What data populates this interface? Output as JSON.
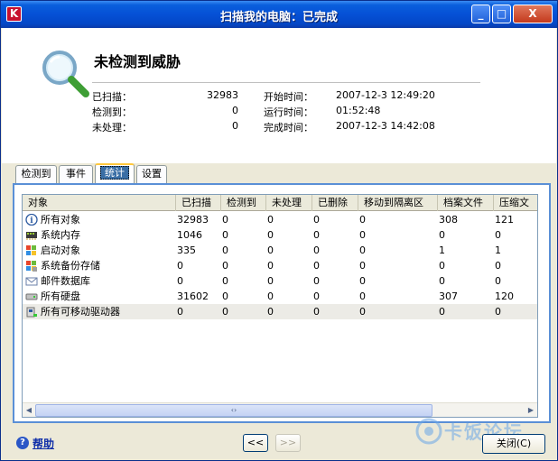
{
  "window": {
    "title": "扫描我的电脑：已完成",
    "app_icon_letter": "K",
    "controls": {
      "minimize": "_",
      "maximize": "□",
      "close": "X"
    }
  },
  "header": {
    "headline": "未检测到威胁",
    "stats": [
      {
        "label": "已扫描：",
        "value": "32983",
        "label2": "开始时间：",
        "value2": "2007-12-3 12:49:20"
      },
      {
        "label": "检测到：",
        "value": "0",
        "label2": "运行时间：",
        "value2": "01:52:48"
      },
      {
        "label": "未处理：",
        "value": "0",
        "label2": "完成时间：",
        "value2": "2007-12-3 14:42:08"
      }
    ]
  },
  "tabs": [
    {
      "label": "检测到",
      "active": false
    },
    {
      "label": "事件",
      "active": false
    },
    {
      "label": "统计",
      "active": true
    },
    {
      "label": "设置",
      "active": false
    }
  ],
  "table": {
    "columns": [
      "对象",
      "已扫描",
      "检测到",
      "未处理",
      "已删除",
      "移动到隔离区",
      "档案文件",
      "压缩文"
    ],
    "rows": [
      {
        "icon": "info-icon",
        "cells": [
          "所有对象",
          "32983",
          "0",
          "0",
          "0",
          "0",
          "308",
          "121"
        ]
      },
      {
        "icon": "memory-icon",
        "cells": [
          "系统内存",
          "1046",
          "0",
          "0",
          "0",
          "0",
          "0",
          "0"
        ]
      },
      {
        "icon": "windows-icon",
        "cells": [
          "启动对象",
          "335",
          "0",
          "0",
          "0",
          "0",
          "1",
          "1"
        ]
      },
      {
        "icon": "windows-backup-icon",
        "cells": [
          "系统备份存储",
          "0",
          "0",
          "0",
          "0",
          "0",
          "0",
          "0"
        ]
      },
      {
        "icon": "mail-database-icon",
        "cells": [
          "邮件数据库",
          "0",
          "0",
          "0",
          "0",
          "0",
          "0",
          "0"
        ]
      },
      {
        "icon": "hard-disk-icon",
        "cells": [
          "所有硬盘",
          "31602",
          "0",
          "0",
          "0",
          "0",
          "307",
          "120"
        ]
      },
      {
        "icon": "removable-drive-icon",
        "cells": [
          "所有可移动驱动器",
          "0",
          "0",
          "0",
          "0",
          "0",
          "0",
          "0"
        ]
      }
    ],
    "scroll_thumb_glyph": "‹›",
    "scroll_left": "◀",
    "scroll_right": "▶"
  },
  "footer": {
    "help_label": "帮助",
    "prev_label": "<<",
    "next_label": ">>",
    "close_label": "关闭(C)",
    "watermark": "卡饭论坛"
  },
  "colors": {
    "titlebar": "#0550d6",
    "panel_border": "#5a8fd6",
    "brand_red": "#c8102e"
  }
}
